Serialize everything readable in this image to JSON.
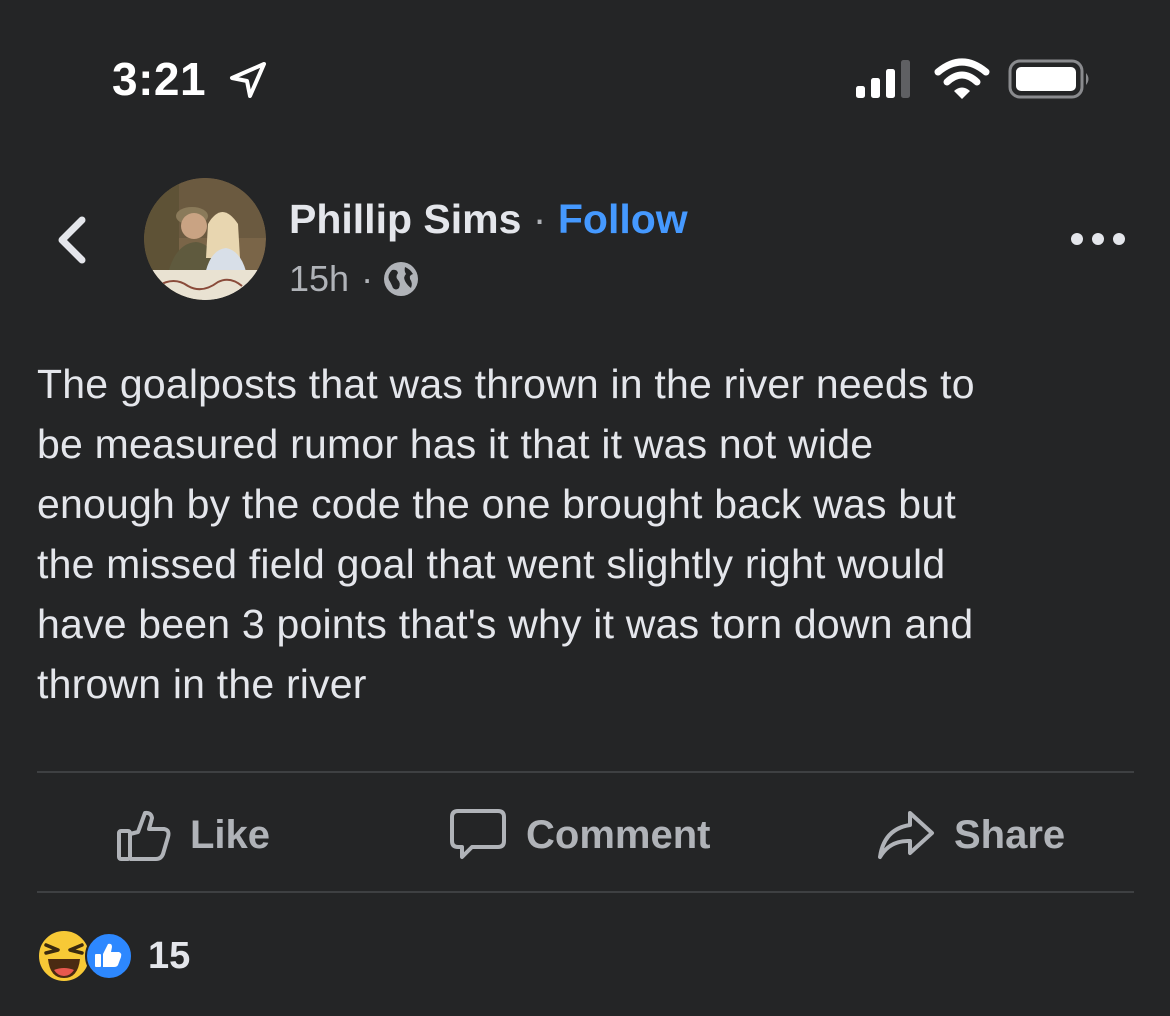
{
  "status_bar": {
    "time": "3:21"
  },
  "post": {
    "author": "Phillip Sims",
    "separator": "·",
    "follow_label": "Follow",
    "timestamp": "15h",
    "meta_separator": "·",
    "privacy_icon": "globe-icon",
    "text_lines": [
      "The goalposts that was thrown in the river needs to",
      "be measured rumor has it that it was not wide",
      "enough by the code the one brought back was but",
      "the missed field goal that went slightly right would",
      "have been 3 points that's why it was torn down and",
      "thrown in the river"
    ]
  },
  "actions": {
    "like": "Like",
    "comment": "Comment",
    "share": "Share"
  },
  "reactions": {
    "types": [
      "haha",
      "like"
    ],
    "count": "15"
  },
  "colors": {
    "background": "#242526",
    "text": "#e4e6eb",
    "secondary": "#b0b3b8",
    "accent": "#4599ff"
  }
}
